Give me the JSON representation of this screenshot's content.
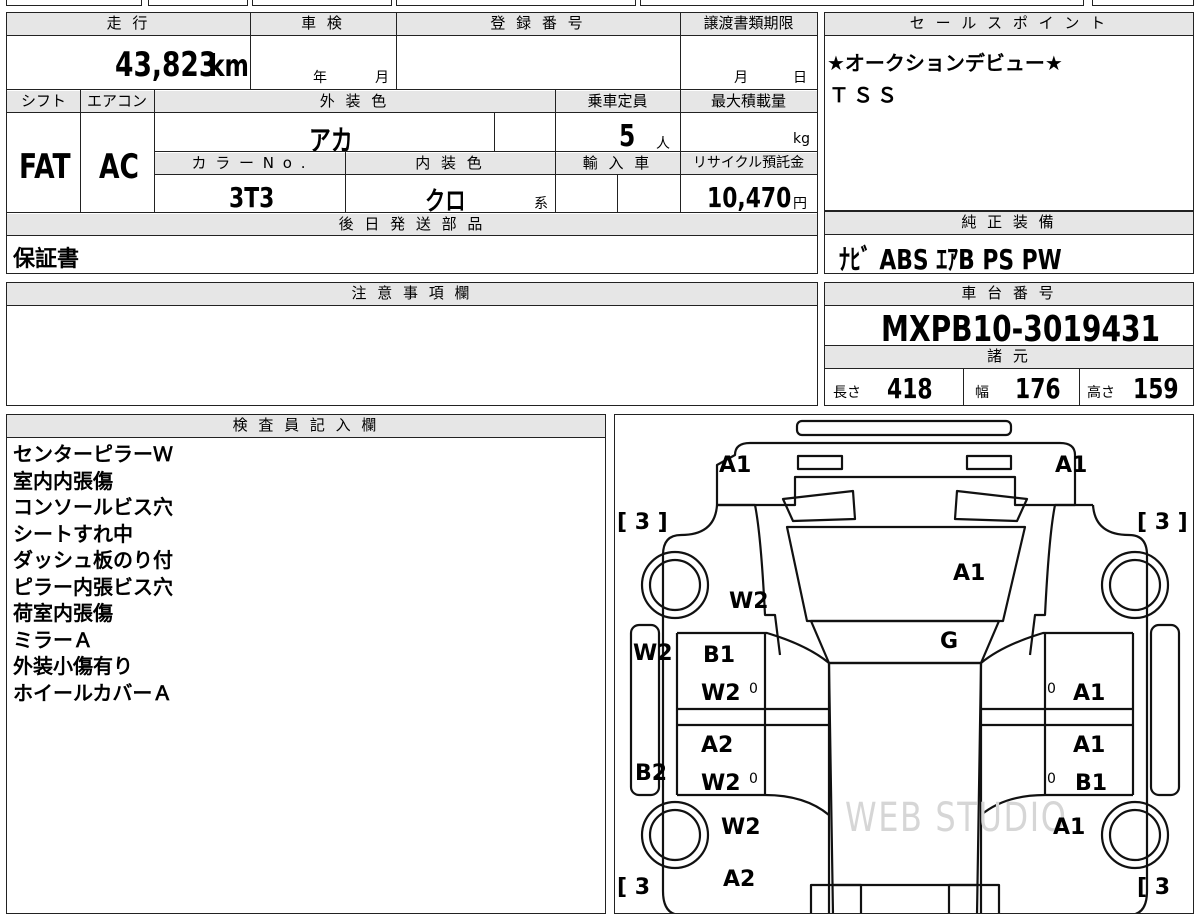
{
  "top_table": {
    "mileage_label": "走 行",
    "mileage_value": "43,823",
    "mileage_unit": "km",
    "inspection_label": "車 検",
    "inspection_year": "年",
    "inspection_month": "月",
    "registration_label": "登 録 番 号",
    "transfer_label": "譲渡書類期限",
    "transfer_month": "月",
    "transfer_day": "日",
    "shift_label": "シフト",
    "shift_value": "FAT",
    "ac_label": "エアコン",
    "ac_value": "AC",
    "exterior_label": "外 装 色",
    "exterior_value": "アカ",
    "capacity_label": "乗車定員",
    "capacity_value": "5",
    "capacity_unit": "人",
    "maxload_label": "最大積載量",
    "maxload_unit": "kg",
    "color_no_label": "カ ラ ー N o .",
    "color_no_value": "3T3",
    "interior_label": "内 装 色",
    "interior_value": "クロ",
    "interior_suffix": "系",
    "import_label": "輸 入 車",
    "recycle_label": "リサイクル預託金",
    "recycle_value": "10,470",
    "recycle_unit": "円",
    "later_label": "後 日 発 送 部 品",
    "later_value": "保証書"
  },
  "sales": {
    "label": "セ ー ル ス ポ イ ン ト",
    "lines": [
      "★オークションデビュー★",
      "ＴＳＳ"
    ]
  },
  "equipment": {
    "label": "純 正 装 備",
    "value": "ﾅﾋﾞ ABS ｴｱB PS PW"
  },
  "caution": {
    "label": "注 意 事 項 欄"
  },
  "chassis": {
    "label": "車 台 番 号",
    "value": "MXPB10-3019431",
    "spec_label": "諸 元",
    "length_label": "長さ",
    "length_value": "418",
    "width_label": "幅",
    "width_value": "176",
    "height_label": "高さ",
    "height_value": "159"
  },
  "inspector": {
    "label": "検 査 員 記 入 欄",
    "notes": [
      "センターピラーＷ",
      "室内内張傷",
      "コンソールビス穴",
      "シートすれ中",
      "ダッシュ板のり付",
      "ピラー内張ビス穴",
      "荷室内張傷",
      "ミラーＡ",
      "外装小傷有り",
      "ホイールカバーＡ"
    ]
  },
  "map": {
    "tread_left_top": "[ 3 ]",
    "tread_right_top": "[ 3 ]",
    "tread_left_bottom": "[ 3",
    "tread_right_bottom": "[ 3",
    "a1_front_left": "A1",
    "a1_front_right": "A1",
    "hood": "A1",
    "windshield": "G",
    "w2_front_fender": "W2",
    "w2_left_side": "W2",
    "b1_front_door": "B1",
    "w2_front_door": "W2",
    "zero_1": "0",
    "zero_2": "0",
    "zero_3": "0",
    "zero_4": "0",
    "a1_right_front_door": "A1",
    "a2_rear_door": "A2",
    "w2_rear_door": "W2",
    "a1_right_rear_door": "A1",
    "b1_right_rear_door": "B1",
    "b2_left_side": "B2",
    "w2_rear_fender": "W2",
    "a1_rear_right": "A1",
    "a2_rear": "A2",
    "watermark": "WEB STUDIO"
  }
}
